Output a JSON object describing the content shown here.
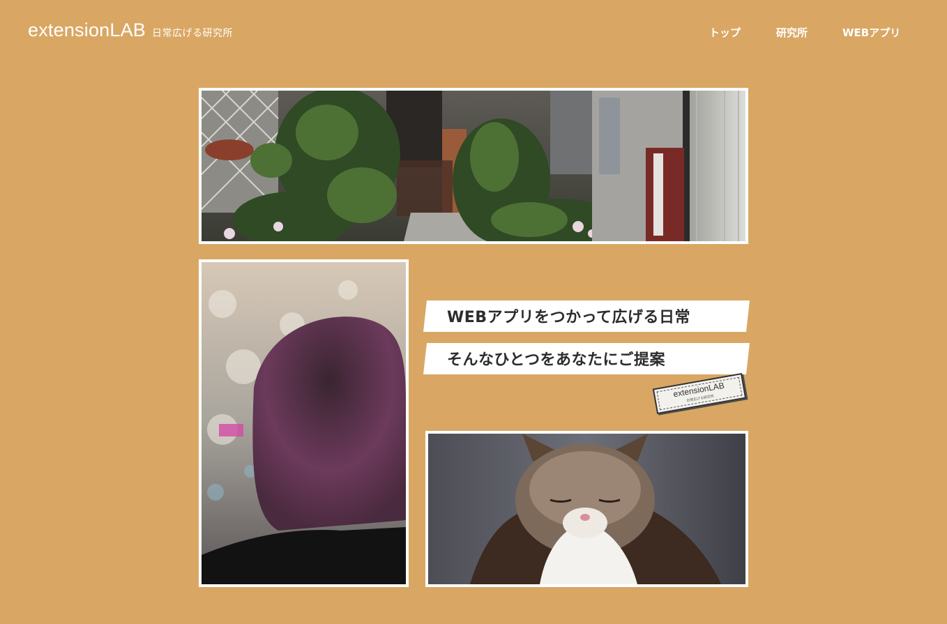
{
  "header": {
    "logo": "extensionLAB",
    "tagline": "日常広げる研究所"
  },
  "nav": {
    "items": [
      "トップ",
      "研究所",
      "WEBアプリ"
    ]
  },
  "main": {
    "tagline_1": "WEBアプリをつかって広げる日常",
    "tagline_2": "そんなひとつをあなたにご提案"
  },
  "stamp": {
    "main": "extensionLAB",
    "sub": "日常広げる研究所"
  },
  "images": {
    "hero": "alley-with-plants-photo",
    "woman": "woman-purple-hair-photo",
    "cat": "sleeping-cat-photo"
  },
  "colors": {
    "background": "#d9a763",
    "text_dark": "#2c2c2c",
    "white": "#ffffff"
  }
}
